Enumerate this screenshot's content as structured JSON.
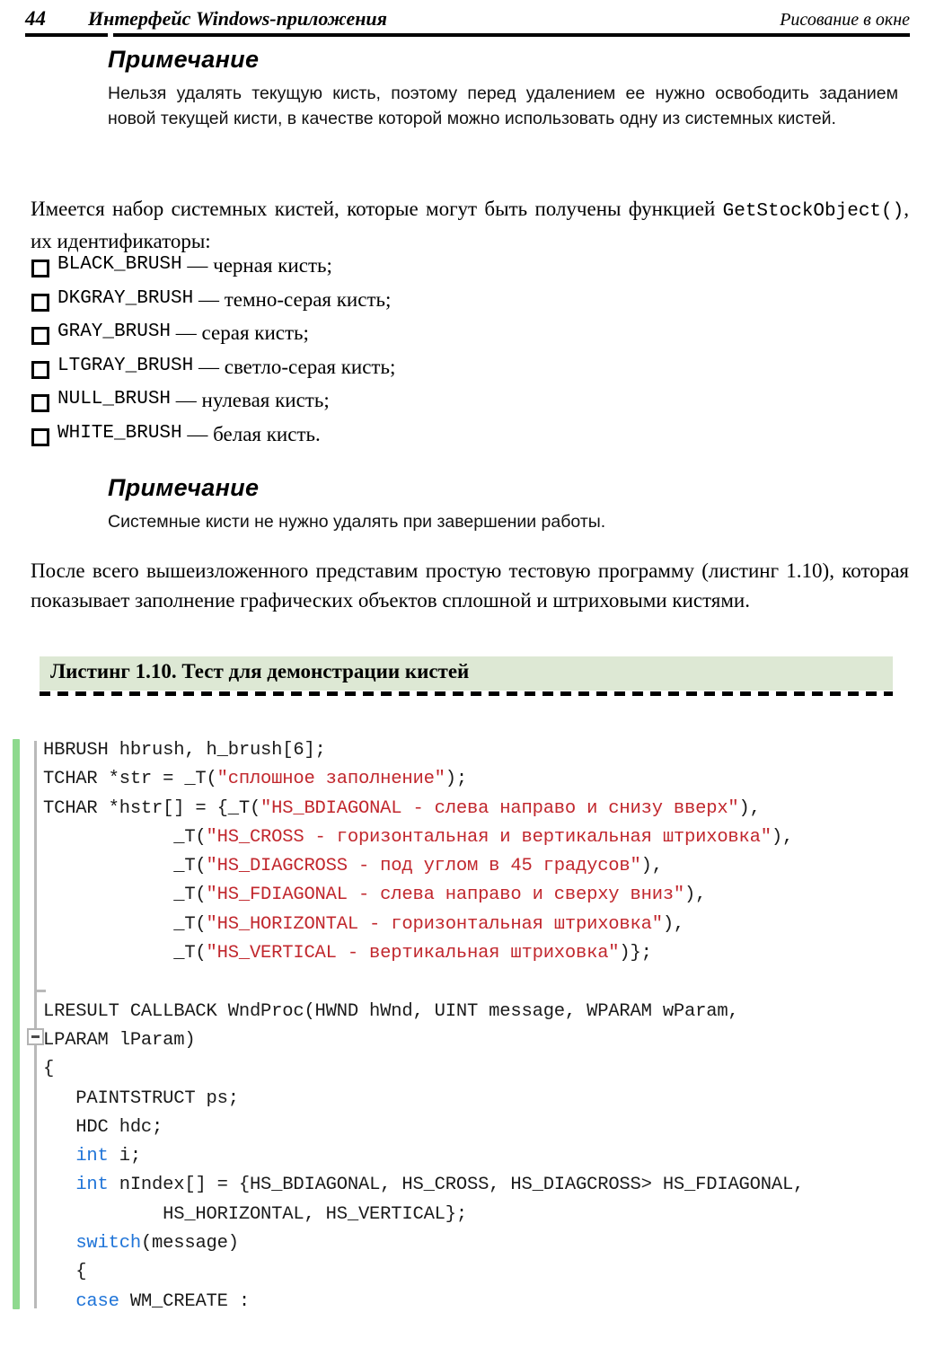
{
  "page_header": {
    "folio": "44",
    "left_title": "Интерфейс Windows-приложения",
    "right_title": "Рисование в окне"
  },
  "note1": {
    "title": "Примечание",
    "body": "Нельзя удалять текущую кисть, поэтому перед удалением ее нужно освободить заданием новой текущей кисти, в качестве которой можно использовать одну из системных кистей."
  },
  "paragraph1": {
    "text_before": "Имеется набор системных кистей, которые могут быть получены функцией ",
    "mono": "GetStockObject()",
    "text_after": ", их идентификаторы:"
  },
  "brush_list": [
    {
      "code": "BLACK_BRUSH",
      "desc": " — черная кисть;"
    },
    {
      "code": "DKGRAY_BRUSH",
      "desc": " — темно-серая кисть;"
    },
    {
      "code": "GRAY_BRUSH",
      "desc": " — серая кисть;"
    },
    {
      "code": "LTGRAY_BRUSH",
      "desc": " — светло-серая кисть;"
    },
    {
      "code": "NULL_BRUSH",
      "desc": " — нулевая кисть;"
    },
    {
      "code": "WHITE_BRUSH",
      "desc": " — белая кисть."
    }
  ],
  "note2": {
    "title": "Примечание",
    "body": "Системные кисти не нужно удалять при завершении работы."
  },
  "paragraph2": {
    "text": "После всего вышеизложенного представим простую тестовую программу (листинг 1.10), которая показывает заполнение графических объектов сплошной и штриховыми кистями."
  },
  "listing": {
    "caption": "Листинг 1.10. Тест для демонстрации кистей",
    "band_color": "#dde8d4",
    "accent_color": "#8ed98e",
    "string_color": "#c1272d",
    "keyword_color": "#1f74d8",
    "code_lines": [
      {
        "segments": [
          {
            "t": "HBRUSH hbrush, h_brush[6];",
            "c": "plain"
          }
        ]
      },
      {
        "segments": [
          {
            "t": "TCHAR *str = _T(",
            "c": "plain"
          },
          {
            "t": "\"сплошное заполнение\"",
            "c": "str"
          },
          {
            "t": ");",
            "c": "plain"
          }
        ]
      },
      {
        "segments": [
          {
            "t": "TCHAR *hstr[] = {_T(",
            "c": "plain"
          },
          {
            "t": "\"HS_BDIAGONAL - слева направо и снизу вверх\"",
            "c": "str"
          },
          {
            "t": "),",
            "c": "plain"
          }
        ]
      },
      {
        "segments": [
          {
            "t": "            _T(",
            "c": "plain"
          },
          {
            "t": "\"HS_CROSS - горизонтальная и вертикальная штриховка\"",
            "c": "str"
          },
          {
            "t": "),",
            "c": "plain"
          }
        ]
      },
      {
        "segments": [
          {
            "t": "            _T(",
            "c": "plain"
          },
          {
            "t": "\"HS_DIAGCROSS - под углом в 45 градусов\"",
            "c": "str"
          },
          {
            "t": "),",
            "c": "plain"
          }
        ]
      },
      {
        "segments": [
          {
            "t": "            _T(",
            "c": "plain"
          },
          {
            "t": "\"HS_FDIAGONAL - слева направо и сверху вниз\"",
            "c": "str"
          },
          {
            "t": "),",
            "c": "plain"
          }
        ]
      },
      {
        "segments": [
          {
            "t": "            _T(",
            "c": "plain"
          },
          {
            "t": "\"HS_HORIZONTAL - горизонтальная штриховка\"",
            "c": "str"
          },
          {
            "t": "),",
            "c": "plain"
          }
        ]
      },
      {
        "segments": [
          {
            "t": "            _T(",
            "c": "plain"
          },
          {
            "t": "\"HS_VERTICAL - вертикальная штриховка\"",
            "c": "str"
          },
          {
            "t": ")};",
            "c": "plain"
          }
        ]
      },
      {
        "segments": [
          {
            "t": "",
            "c": "plain"
          }
        ]
      },
      {
        "segments": [
          {
            "t": "LRESULT CALLBACK WndProc(HWND hWnd, UINT message, WPARAM wParam,",
            "c": "plain"
          }
        ]
      },
      {
        "segments": [
          {
            "t": "LPARAM lParam)",
            "c": "plain"
          }
        ]
      },
      {
        "segments": [
          {
            "t": "{",
            "c": "plain"
          }
        ]
      },
      {
        "segments": [
          {
            "t": "   PAINTSTRUCT ps;",
            "c": "plain"
          }
        ]
      },
      {
        "segments": [
          {
            "t": "   HDC hdc;",
            "c": "plain"
          }
        ]
      },
      {
        "segments": [
          {
            "t": "   ",
            "c": "plain"
          },
          {
            "t": "int",
            "c": "kw"
          },
          {
            "t": " i;",
            "c": "plain"
          }
        ]
      },
      {
        "segments": [
          {
            "t": "   ",
            "c": "plain"
          },
          {
            "t": "int",
            "c": "kw"
          },
          {
            "t": " nIndex[] = {HS_BDIAGONAL, HS_CROSS, HS_DIAGCROSS> HS_FDIAGONAL,",
            "c": "plain"
          }
        ]
      },
      {
        "segments": [
          {
            "t": "           HS_HORIZONTAL, HS_VERTICAL};",
            "c": "plain"
          }
        ]
      },
      {
        "segments": [
          {
            "t": "   ",
            "c": "plain"
          },
          {
            "t": "switch",
            "c": "kw"
          },
          {
            "t": "(message)",
            "c": "plain"
          }
        ]
      },
      {
        "segments": [
          {
            "t": "   {",
            "c": "plain"
          }
        ]
      },
      {
        "segments": [
          {
            "t": "   ",
            "c": "plain"
          },
          {
            "t": "case",
            "c": "kw"
          },
          {
            "t": " WM_CREATE :",
            "c": "plain"
          }
        ]
      }
    ]
  }
}
